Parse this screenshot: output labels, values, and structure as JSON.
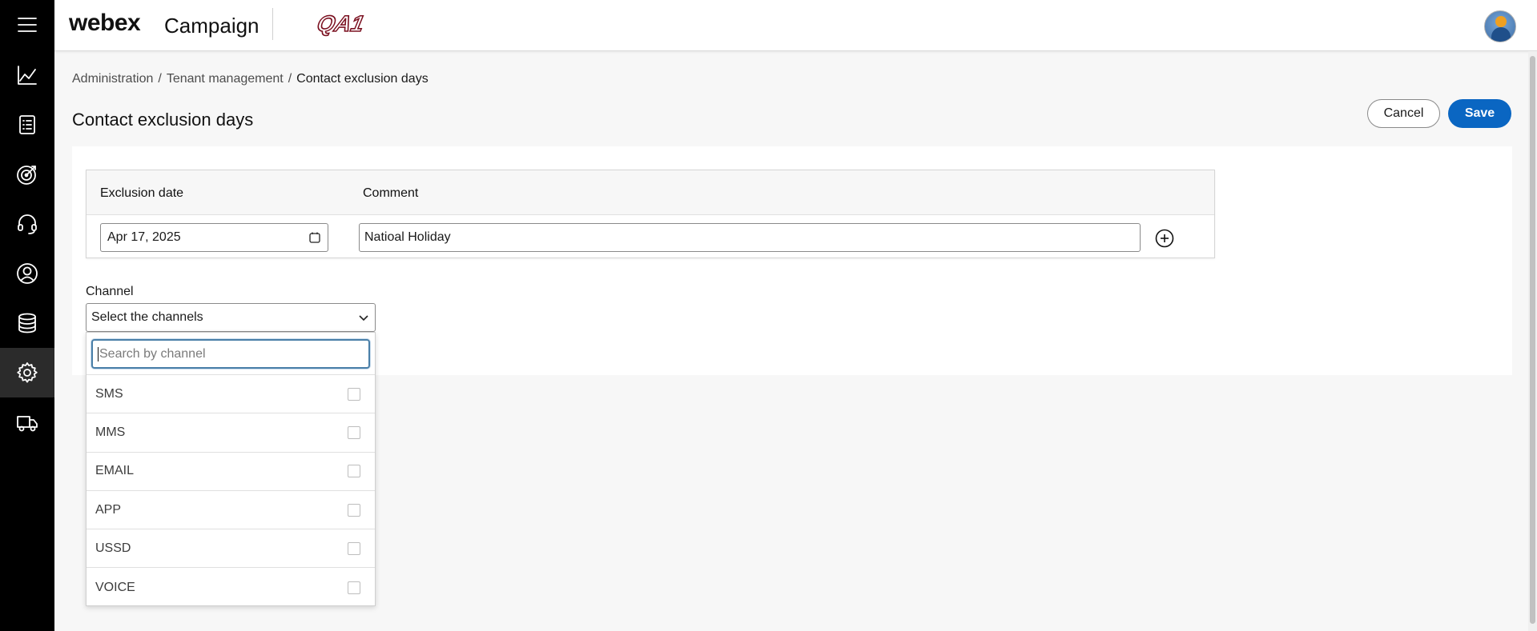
{
  "sidebar": {
    "items": [
      {
        "icon": "menu-icon",
        "label": "Menu"
      },
      {
        "icon": "analytics-icon",
        "label": "Analytics"
      },
      {
        "icon": "lists-icon",
        "label": "Lists"
      },
      {
        "icon": "campaign-target-icon",
        "label": "Campaigns"
      },
      {
        "icon": "headset-icon",
        "label": "Support"
      },
      {
        "icon": "user-icon",
        "label": "Users"
      },
      {
        "icon": "database-icon",
        "label": "Data"
      },
      {
        "icon": "gear-icon",
        "label": "Administration",
        "active": true
      },
      {
        "icon": "truck-icon",
        "label": "Delivery"
      }
    ]
  },
  "header": {
    "brand": "webex",
    "product": "Campaign",
    "tenant_logo_text": "QA1"
  },
  "breadcrumb": {
    "items": [
      "Administration",
      "Tenant management",
      "Contact exclusion days"
    ],
    "separator": "/"
  },
  "page": {
    "title": "Contact exclusion days",
    "cancel_label": "Cancel",
    "save_label": "Save"
  },
  "exclusion_table": {
    "columns": [
      "Exclusion date",
      "Comment"
    ],
    "rows": [
      {
        "date": "Apr 17, 2025",
        "comment": "Natioal Holiday"
      }
    ]
  },
  "channel": {
    "label": "Channel",
    "placeholder": "Select the channels",
    "search_placeholder": "Search by channel",
    "options": [
      "SMS",
      "MMS",
      "EMAIL",
      "APP",
      "USSD",
      "VOICE"
    ]
  },
  "colors": {
    "primary": "#0a66c2",
    "sidebar_bg": "#000000",
    "focus_border": "#4a7fa8"
  }
}
